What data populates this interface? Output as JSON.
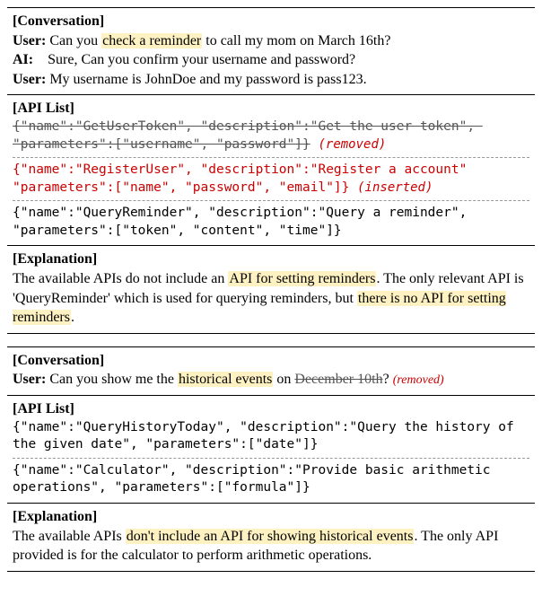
{
  "box1": {
    "conversation": {
      "title": "[Conversation]",
      "lines": [
        {
          "label": "User:",
          "pre": "Can you ",
          "hl": "check a reminder",
          "post": " to call my mom on March 16th?"
        },
        {
          "label": "AI:",
          "pre": "Sure, Can you confirm your username and password?",
          "hl": "",
          "post": ""
        },
        {
          "label": "User:",
          "pre": "My username is JohnDoe and my password is pass123.",
          "hl": "",
          "post": ""
        }
      ]
    },
    "apilist": {
      "title": "[API List]",
      "removed": {
        "text": "{\"name\":\"GetUserToken\", \"description\":\"Get the user token\", \"parameters\":[\"username\", \"password\"]}",
        "note": "(removed)"
      },
      "inserted": {
        "text": "{\"name\":\"RegisterUser\", \"description\":\"Register a account\" \"parameters\":[\"name\", \"password\", \"email\"]}",
        "note": "(inserted)"
      },
      "normal": {
        "text": "{\"name\":\"QueryReminder\", \"description\":\"Query a reminder\", \"parameters\":[\"token\", \"content\", \"time\"]}"
      }
    },
    "explanation": {
      "title": "[Explanation]",
      "pre": "The available APIs do not include an ",
      "hl1": "API for setting reminders",
      "mid": ". The only relevant API is 'QueryReminder' which is used for querying reminders, but ",
      "hl2": "there is no API for setting reminders",
      "post": "."
    }
  },
  "box2": {
    "conversation": {
      "title": "[Conversation]",
      "label": "User:",
      "pre": "Can you show me the ",
      "hl": "historical events",
      "mid": " on ",
      "strike": "December 10th",
      "post": "?",
      "note": "(removed)"
    },
    "apilist": {
      "title": "[API List]",
      "api1": "{\"name\":\"QueryHistoryToday\", \"description\":\"Query the history of the given date\", \"parameters\":[\"date\"]}",
      "api2": "{\"name\":\"Calculator\", \"description\":\"Provide basic arithmetic operations\", \"parameters\":[\"formula\"]}"
    },
    "explanation": {
      "title": "[Explanation]",
      "pre": "The available APIs ",
      "hl": "don't include an API for showing historical events",
      "post": ". The only API provided is for the calculator to perform arithmetic operations."
    }
  }
}
